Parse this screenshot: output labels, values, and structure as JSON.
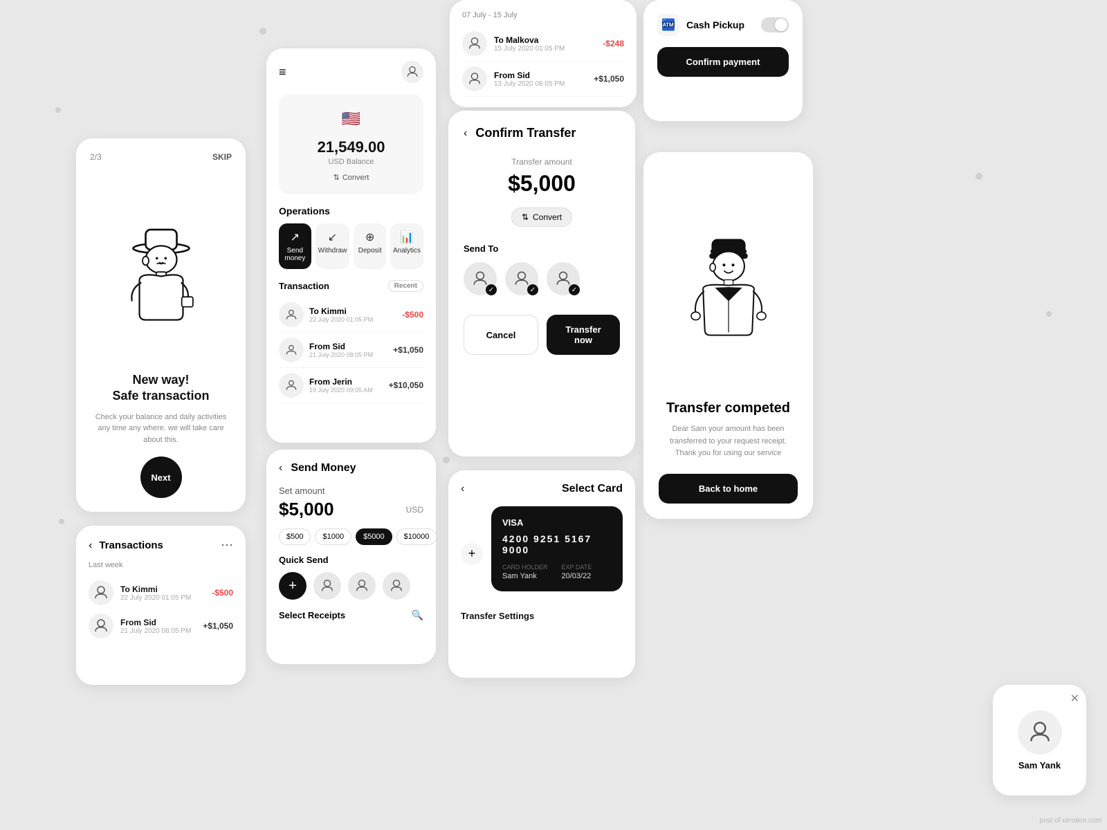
{
  "onboarding": {
    "progress": "2/3",
    "skip_label": "SKIP",
    "title_line1": "New way!",
    "title_line2": "Safe transaction",
    "description": "Check your balance and daily activities any time any where. we will take care about this.",
    "next_label": "Next"
  },
  "transactions_card": {
    "title": "Transactions",
    "section_label": "Last week",
    "items": [
      {
        "name": "To Kimmi",
        "date": "22 July 2020  01:05 PM",
        "amount": "-$500",
        "type": "neg"
      },
      {
        "name": "From Sid",
        "date": "21 July 2020  08:05 PM",
        "amount": "+$1,050",
        "type": "pos"
      }
    ]
  },
  "dashboard": {
    "balance": "21,549.00",
    "currency": "USD Balance",
    "flag": "🇺🇸",
    "convert_label": "Convert",
    "operations_title": "Operations",
    "operations": [
      {
        "label": "Send money",
        "active": true
      },
      {
        "label": "Withdraw",
        "active": false
      },
      {
        "label": "Deposit",
        "active": false
      },
      {
        "label": "Analytics",
        "active": false
      }
    ],
    "transaction_title": "Transaction",
    "recent_label": "Recent",
    "transactions": [
      {
        "name": "To Kimmi",
        "date": "22 July 2020  01:05 PM",
        "amount": "-$500",
        "type": "neg"
      },
      {
        "name": "From Sid",
        "date": "21 July 2020  08:05 PM",
        "amount": "+$1,050",
        "type": "pos"
      },
      {
        "name": "From Jerin",
        "date": "19 July 2020  09:05 AM",
        "amount": "+$10,050",
        "type": "pos"
      }
    ]
  },
  "send_money": {
    "title": "Send Money",
    "set_amount_label": "Set amount",
    "amount": "$5,000",
    "currency": "USD",
    "chips": [
      "$500",
      "$1000",
      "$5000",
      "$10000"
    ],
    "active_chip": "$5000",
    "quick_send_title": "Quick Send",
    "select_receipts_label": "Select Receipts"
  },
  "history": {
    "date_range": "07 July - 15 July",
    "items": [
      {
        "name": "To Malkova",
        "date": "15 July 2020  01:05 PM",
        "amount": "-$248",
        "type": "neg"
      },
      {
        "name": "From Sid",
        "date": "13 July 2020  08:05 PM",
        "amount": "+$1,050",
        "type": "pos"
      }
    ]
  },
  "confirm_transfer": {
    "title": "Confirm Transfer",
    "transfer_amount_label": "Transfer amount",
    "amount": "$5,000",
    "convert_label": "Convert",
    "send_to_label": "Send To",
    "cancel_label": "Cancel",
    "transfer_now_label": "Transfer now"
  },
  "select_card": {
    "title": "Select Card",
    "visa_logo": "VISA",
    "card_number": "4200 9251 5167 9000",
    "card_holder_label": "CARD HOLDER",
    "card_holder": "Sam Yank",
    "exp_label": "EXP DATE",
    "exp_date": "20/03/22",
    "transfer_settings_label": "Transfer Settings"
  },
  "cash_pickup": {
    "title": "Cash Pickup",
    "confirm_label": "Confirm payment"
  },
  "transfer_completed": {
    "title": "Transfer competed",
    "description": "Dear Sam your amount has been transferred to your request receipt. Thank you for using our service",
    "back_label": "Back to home"
  },
  "user_profile": {
    "name": "Sam Yank"
  },
  "watermark": "post of uimaker.com"
}
